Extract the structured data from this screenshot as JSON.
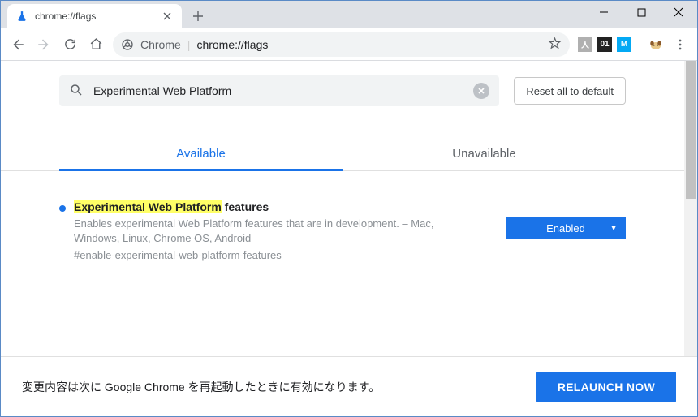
{
  "window": {
    "tab_title": "chrome://flags"
  },
  "omnibox": {
    "origin": "Chrome",
    "path": "chrome://flags"
  },
  "extensions": {
    "pdf": "人",
    "zeroone": "01",
    "m": "M"
  },
  "flags_page": {
    "search_value": "Experimental Web Platform",
    "reset_label": "Reset all to default",
    "tab_available": "Available",
    "tab_unavailable": "Unavailable",
    "flag": {
      "title_hl": "Experimental Web Platform",
      "title_rest": " features",
      "description": "Enables experimental Web Platform features that are in development. – Mac, Windows, Linux, Chrome OS, Android",
      "id": "#enable-experimental-web-platform-features",
      "state": "Enabled"
    }
  },
  "footer": {
    "message": "変更内容は次に Google Chrome を再起動したときに有効になります。",
    "relaunch": "RELAUNCH NOW"
  }
}
